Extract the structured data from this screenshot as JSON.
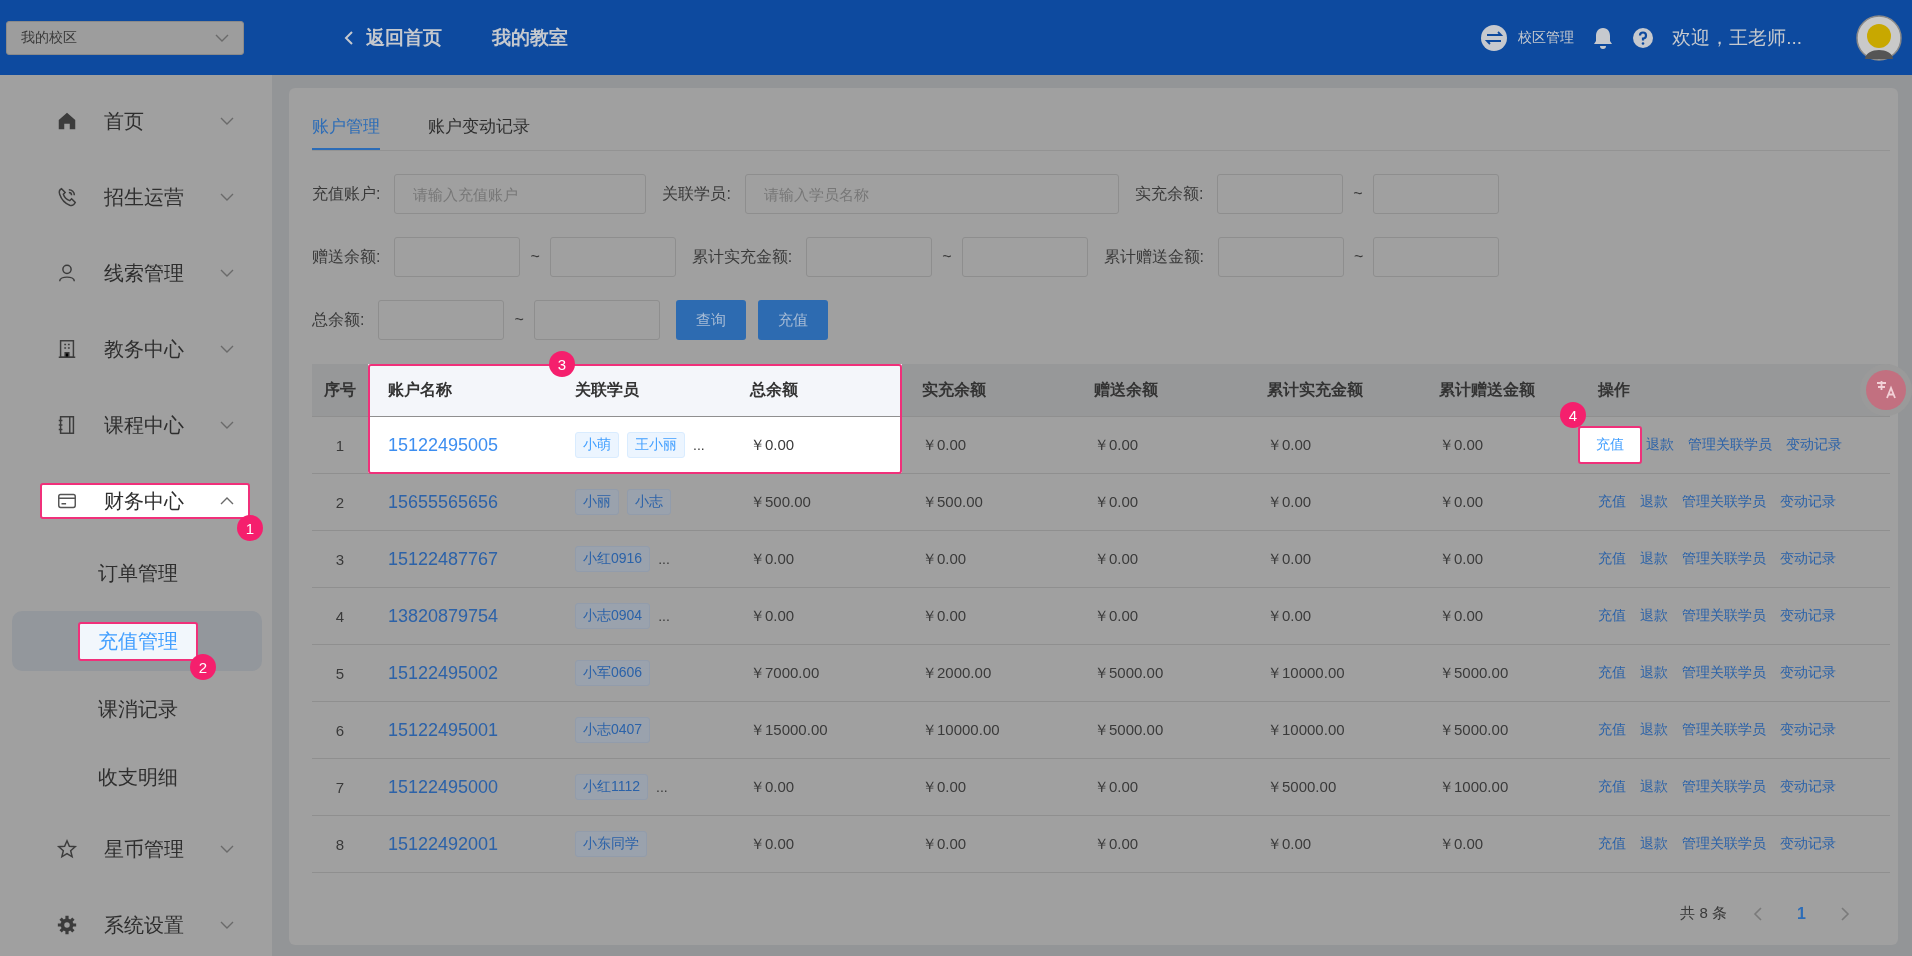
{
  "header": {
    "campus_select": "我的校区",
    "back_link": "返回首页",
    "nav_title": "我的教室",
    "campus_manage": "校区管理",
    "welcome": "欢迎，王老师..."
  },
  "sidebar": {
    "items": [
      {
        "label": "首页",
        "expanded": false,
        "spotlight": false
      },
      {
        "label": "招生运营",
        "expanded": false,
        "spotlight": false
      },
      {
        "label": "线索管理",
        "expanded": false,
        "spotlight": false
      },
      {
        "label": "教务中心",
        "expanded": false,
        "spotlight": false
      },
      {
        "label": "课程中心",
        "expanded": false,
        "spotlight": false
      },
      {
        "label": "财务中心",
        "expanded": true,
        "spotlight": true,
        "badge": "1",
        "children": [
          {
            "label": "订单管理",
            "selected": false,
            "spotlight": false
          },
          {
            "label": "充值管理",
            "selected": true,
            "spotlight": true,
            "badge": "2"
          },
          {
            "label": "课消记录",
            "selected": false,
            "spotlight": false
          },
          {
            "label": "收支明细",
            "selected": false,
            "spotlight": false
          }
        ]
      },
      {
        "label": "星币管理",
        "expanded": false,
        "spotlight": false
      },
      {
        "label": "系统设置",
        "expanded": false,
        "spotlight": false
      }
    ]
  },
  "tabs": [
    {
      "label": "账户管理",
      "selected": true
    },
    {
      "label": "账户变动记录",
      "selected": false
    }
  ],
  "filter_rows": [
    {
      "fields": [
        {
          "label": "充值账户:",
          "kind": "text",
          "placeholder": "请输入充值账户"
        },
        {
          "label": "关联学员:",
          "kind": "text",
          "placeholder": "请输入学员名称"
        },
        {
          "label": "实充余额:",
          "kind": "range",
          "separator": "~"
        }
      ]
    },
    {
      "fields": [
        {
          "label": "赠送余额:",
          "kind": "range",
          "separator": "~"
        },
        {
          "label": "累计实充金额:",
          "kind": "range",
          "separator": "~"
        },
        {
          "label": "累计赠送金额:",
          "kind": "range",
          "separator": "~"
        }
      ]
    },
    {
      "fields": [
        {
          "label": "总余额:",
          "kind": "range",
          "separator": "~"
        }
      ],
      "buttons": [
        "查询",
        "充值"
      ]
    }
  ],
  "table": {
    "header_spotlight": true,
    "badge": "3",
    "columns": [
      {
        "label": "序号",
        "spotlight": false
      },
      {
        "label": "账户名称",
        "spotlight": true
      },
      {
        "label": "关联学员",
        "spotlight": true
      },
      {
        "label": "总余额",
        "spotlight": true
      },
      {
        "label": "实充余额",
        "spotlight": false
      },
      {
        "label": "赠送余额",
        "spotlight": false
      },
      {
        "label": "累计实充金额",
        "spotlight": false
      },
      {
        "label": "累计赠送金额",
        "spotlight": false
      },
      {
        "label": "操作",
        "spotlight": false
      }
    ],
    "rows": [
      {
        "spotlight": true,
        "index": "1",
        "account": "15122495005",
        "students": [
          "小萌",
          "王小丽"
        ],
        "more": "...",
        "total": "￥0.00",
        "actual": "￥0.00",
        "gift": "￥0.00",
        "cum_actual": "￥0.00",
        "cum_gift": "￥0.00",
        "actions": [
          {
            "label": "充值",
            "spotlight": true,
            "badge": "4"
          },
          {
            "label": "退款",
            "spotlight": false
          },
          {
            "label": "管理关联学员",
            "spotlight": false
          },
          {
            "label": "变动记录",
            "spotlight": false
          }
        ]
      },
      {
        "spotlight": false,
        "index": "2",
        "account": "15655565656",
        "students": [
          "小丽",
          "小志"
        ],
        "total": "￥500.00",
        "actual": "￥500.00",
        "gift": "￥0.00",
        "cum_actual": "￥0.00",
        "cum_gift": "￥0.00",
        "actions": [
          {
            "label": "充值",
            "spotlight": false
          },
          {
            "label": "退款",
            "spotlight": false
          },
          {
            "label": "管理关联学员",
            "spotlight": false
          },
          {
            "label": "变动记录",
            "spotlight": false
          }
        ]
      },
      {
        "spotlight": false,
        "index": "3",
        "account": "15122487767",
        "students": [
          "小红0916"
        ],
        "more": "...",
        "total": "￥0.00",
        "actual": "￥0.00",
        "gift": "￥0.00",
        "cum_actual": "￥0.00",
        "cum_gift": "￥0.00",
        "actions": [
          {
            "label": "充值",
            "spotlight": false
          },
          {
            "label": "退款",
            "spotlight": false
          },
          {
            "label": "管理关联学员",
            "spotlight": false
          },
          {
            "label": "变动记录",
            "spotlight": false
          }
        ]
      },
      {
        "spotlight": false,
        "index": "4",
        "account": "13820879754",
        "students": [
          "小志0904"
        ],
        "more": "...",
        "total": "￥0.00",
        "actual": "￥0.00",
        "gift": "￥0.00",
        "cum_actual": "￥0.00",
        "cum_gift": "￥0.00",
        "actions": [
          {
            "label": "充值",
            "spotlight": false
          },
          {
            "label": "退款",
            "spotlight": false
          },
          {
            "label": "管理关联学员",
            "spotlight": false
          },
          {
            "label": "变动记录",
            "spotlight": false
          }
        ]
      },
      {
        "spotlight": false,
        "index": "5",
        "account": "15122495002",
        "students": [
          "小军0606"
        ],
        "total": "￥7000.00",
        "actual": "￥2000.00",
        "gift": "￥5000.00",
        "cum_actual": "￥10000.00",
        "cum_gift": "￥5000.00",
        "actions": [
          {
            "label": "充值",
            "spotlight": false
          },
          {
            "label": "退款",
            "spotlight": false
          },
          {
            "label": "管理关联学员",
            "spotlight": false
          },
          {
            "label": "变动记录",
            "spotlight": false
          }
        ]
      },
      {
        "spotlight": false,
        "index": "6",
        "account": "15122495001",
        "students": [
          "小志0407"
        ],
        "total": "￥15000.00",
        "actual": "￥10000.00",
        "gift": "￥5000.00",
        "cum_actual": "￥10000.00",
        "cum_gift": "￥5000.00",
        "actions": [
          {
            "label": "充值",
            "spotlight": false
          },
          {
            "label": "退款",
            "spotlight": false
          },
          {
            "label": "管理关联学员",
            "spotlight": false
          },
          {
            "label": "变动记录",
            "spotlight": false
          }
        ]
      },
      {
        "spotlight": false,
        "index": "7",
        "account": "15122495000",
        "students": [
          "小红1112"
        ],
        "more": "...",
        "total": "￥0.00",
        "actual": "￥0.00",
        "gift": "￥0.00",
        "cum_actual": "￥5000.00",
        "cum_gift": "￥1000.00",
        "actions": [
          {
            "label": "充值",
            "spotlight": false
          },
          {
            "label": "退款",
            "spotlight": false
          },
          {
            "label": "管理关联学员",
            "spotlight": false
          },
          {
            "label": "变动记录",
            "spotlight": false
          }
        ]
      },
      {
        "spotlight": false,
        "index": "8",
        "account": "15122492001",
        "students": [
          "小东同学"
        ],
        "total": "￥0.00",
        "actual": "￥0.00",
        "gift": "￥0.00",
        "cum_actual": "￥0.00",
        "cum_gift": "￥0.00",
        "actions": [
          {
            "label": "充值",
            "spotlight": false
          },
          {
            "label": "退款",
            "spotlight": false
          },
          {
            "label": "管理关联学员",
            "spotlight": false
          },
          {
            "label": "变动记录",
            "spotlight": false
          }
        ]
      }
    ]
  },
  "pagination": {
    "total": "共 8 条",
    "pages": [
      {
        "label": "1",
        "selected": true
      }
    ]
  }
}
